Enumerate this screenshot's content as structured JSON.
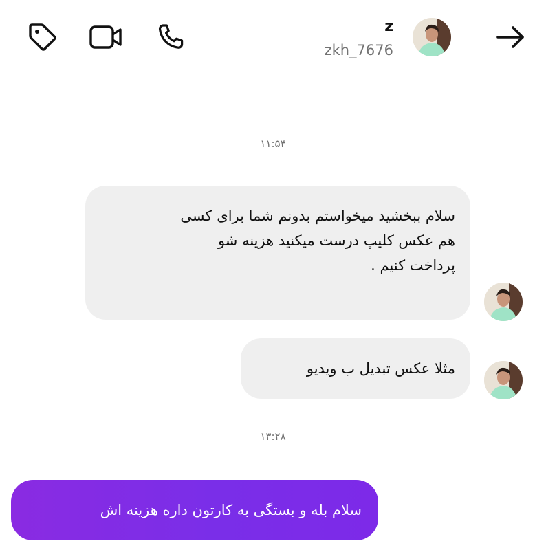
{
  "header": {
    "profile_name": "z",
    "profile_handle": "zkh_7676",
    "icons": [
      "tag-icon",
      "video-call-icon",
      "phone-icon",
      "back-arrow-icon"
    ]
  },
  "thread": {
    "timestamp_1": "۱۱:۵۴",
    "timestamp_2": "۱۳:۲۸",
    "messages": [
      {
        "direction": "incoming",
        "lines": [
          "سلام ببخشید میخواستم بدونم شما برای کسی",
          "هم عکس کلیپ درست میکنید هزینه شو",
          "پرداخت کنیم ."
        ]
      },
      {
        "direction": "incoming",
        "lines": [
          "مثلا عکس تبدیل ب ویدیو"
        ]
      },
      {
        "direction": "outgoing",
        "lines": [
          "سلام بله و بستگی به کارتون داره هزینه اش"
        ]
      }
    ]
  },
  "colors": {
    "incoming_bubble": "#efefef",
    "outgoing_bubble": "#7d2ae8",
    "secondary_text": "#737373"
  }
}
